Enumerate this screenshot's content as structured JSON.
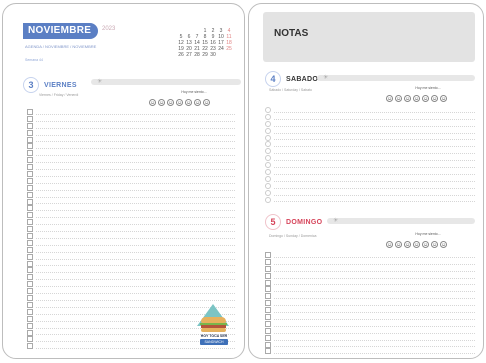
{
  "left_page": {
    "month": "NOVIEMBRE",
    "year": "2023",
    "subtitle": "AGENDA / NOVIEMBRE / NOVIEMBRE",
    "small_link": "Semana 44",
    "calendar": [
      [
        "",
        "",
        "",
        "1",
        "2",
        "3",
        "4"
      ],
      [
        "5",
        "6",
        "7",
        "8",
        "9",
        "10",
        "11"
      ],
      [
        "12",
        "13",
        "14",
        "15",
        "16",
        "17",
        "18"
      ],
      [
        "19",
        "20",
        "21",
        "22",
        "23",
        "24",
        "25"
      ],
      [
        "26",
        "27",
        "28",
        "29",
        "30",
        "",
        ""
      ]
    ],
    "day": {
      "number": "3",
      "name": "VIERNES",
      "sub": "Viernes / Friday / Venerdi",
      "mood_label": "Hoy me siento...",
      "number_color": "#5b7fc4"
    },
    "sticker": {
      "label1": "HOY TOCA SER",
      "label2": "SANDWICH"
    }
  },
  "right_page": {
    "notes_title": "NOTAS",
    "day1": {
      "number": "4",
      "name": "SABADO",
      "sub": "Sábado / Saturday / Sabato",
      "mood_label": "Hoy me siento...",
      "number_color": "#5b7fc4"
    },
    "day2": {
      "number": "5",
      "name": "DOMINGO",
      "sub": "Domingo / Sunday / Domenica",
      "mood_label": "Hoy me siento...",
      "number_color": "#d6445a"
    }
  },
  "icons": {
    "mood": "smiley-face-icon",
    "day_bar": "weather-icon"
  }
}
